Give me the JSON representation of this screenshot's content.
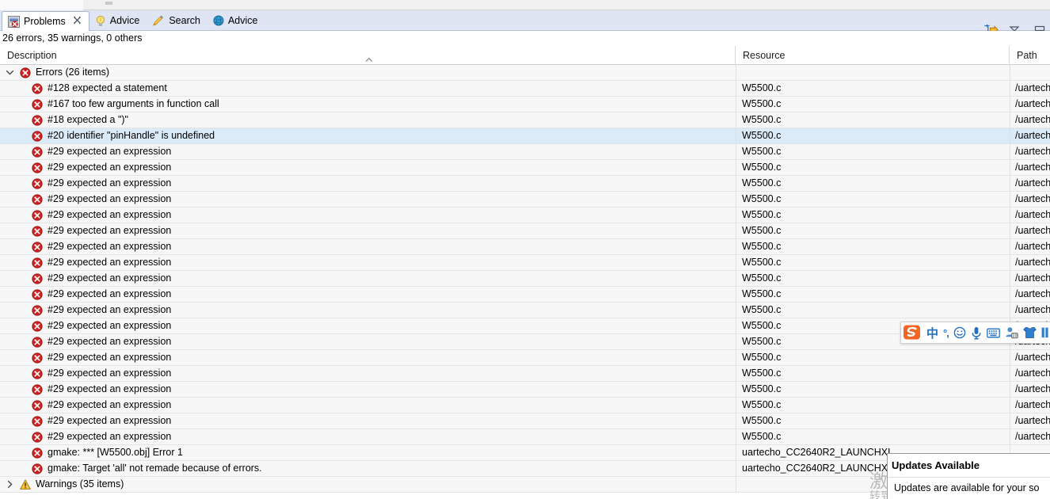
{
  "window": {
    "view_tabs": [
      {
        "label": "Problems",
        "icon": "problems-icon",
        "active": true,
        "closable": true
      },
      {
        "label": "Advice",
        "icon": "bulb-icon",
        "active": false,
        "closable": false
      },
      {
        "label": "Search",
        "icon": "search-icon",
        "active": false,
        "closable": false
      },
      {
        "label": "Advice",
        "icon": "globe-icon",
        "active": false,
        "closable": false
      }
    ],
    "toolbar": [
      {
        "name": "focus-on-active-task-icon",
        "tooltip": "Focus on Active Task"
      },
      {
        "name": "view-menu-icon",
        "tooltip": "View Menu"
      },
      {
        "name": "minimize-icon",
        "tooltip": "Minimize"
      }
    ]
  },
  "summary": "26 errors, 35 warnings, 0 others",
  "table": {
    "columns": [
      {
        "key": "description",
        "label": "Description",
        "sorted": true,
        "sort_direction": "asc"
      },
      {
        "key": "resource",
        "label": "Resource",
        "sorted": false
      },
      {
        "key": "path",
        "label": "Path",
        "sorted": false
      }
    ],
    "rows": [
      {
        "type": "group",
        "expanded": true,
        "severity": "error",
        "description": "Errors (26 items)",
        "resource": "",
        "path": "",
        "selected": false
      },
      {
        "type": "item",
        "severity": "error",
        "description": "#128 expected a statement",
        "resource": "W5500.c",
        "path": "/uartech",
        "selected": false
      },
      {
        "type": "item",
        "severity": "error",
        "description": "#167 too few arguments in function call",
        "resource": "W5500.c",
        "path": "/uartech",
        "selected": false
      },
      {
        "type": "item",
        "severity": "error",
        "description": "#18 expected a \")\"",
        "resource": "W5500.c",
        "path": "/uartech",
        "selected": false
      },
      {
        "type": "item",
        "severity": "error",
        "description": "#20 identifier \"pinHandle\" is undefined",
        "resource": "W5500.c",
        "path": "/uartech",
        "selected": true
      },
      {
        "type": "item",
        "severity": "error",
        "description": "#29 expected an expression",
        "resource": "W5500.c",
        "path": "/uartech",
        "selected": false
      },
      {
        "type": "item",
        "severity": "error",
        "description": "#29 expected an expression",
        "resource": "W5500.c",
        "path": "/uartech",
        "selected": false
      },
      {
        "type": "item",
        "severity": "error",
        "description": "#29 expected an expression",
        "resource": "W5500.c",
        "path": "/uartech",
        "selected": false
      },
      {
        "type": "item",
        "severity": "error",
        "description": "#29 expected an expression",
        "resource": "W5500.c",
        "path": "/uartech",
        "selected": false
      },
      {
        "type": "item",
        "severity": "error",
        "description": "#29 expected an expression",
        "resource": "W5500.c",
        "path": "/uartech",
        "selected": false
      },
      {
        "type": "item",
        "severity": "error",
        "description": "#29 expected an expression",
        "resource": "W5500.c",
        "path": "/uartech",
        "selected": false
      },
      {
        "type": "item",
        "severity": "error",
        "description": "#29 expected an expression",
        "resource": "W5500.c",
        "path": "/uartech",
        "selected": false
      },
      {
        "type": "item",
        "severity": "error",
        "description": "#29 expected an expression",
        "resource": "W5500.c",
        "path": "/uartech",
        "selected": false
      },
      {
        "type": "item",
        "severity": "error",
        "description": "#29 expected an expression",
        "resource": "W5500.c",
        "path": "/uartech",
        "selected": false
      },
      {
        "type": "item",
        "severity": "error",
        "description": "#29 expected an expression",
        "resource": "W5500.c",
        "path": "/uartech",
        "selected": false
      },
      {
        "type": "item",
        "severity": "error",
        "description": "#29 expected an expression",
        "resource": "W5500.c",
        "path": "/uartech",
        "selected": false
      },
      {
        "type": "item",
        "severity": "error",
        "description": "#29 expected an expression",
        "resource": "W5500.c",
        "path": "/uartech",
        "selected": false
      },
      {
        "type": "item",
        "severity": "error",
        "description": "#29 expected an expression",
        "resource": "W5500.c",
        "path": "/uartech",
        "selected": false
      },
      {
        "type": "item",
        "severity": "error",
        "description": "#29 expected an expression",
        "resource": "W5500.c",
        "path": "/uartech",
        "selected": false
      },
      {
        "type": "item",
        "severity": "error",
        "description": "#29 expected an expression",
        "resource": "W5500.c",
        "path": "/uartech",
        "selected": false
      },
      {
        "type": "item",
        "severity": "error",
        "description": "#29 expected an expression",
        "resource": "W5500.c",
        "path": "/uartech",
        "selected": false
      },
      {
        "type": "item",
        "severity": "error",
        "description": "#29 expected an expression",
        "resource": "W5500.c",
        "path": "/uartech",
        "selected": false
      },
      {
        "type": "item",
        "severity": "error",
        "description": "#29 expected an expression",
        "resource": "W5500.c",
        "path": "/uartech",
        "selected": false
      },
      {
        "type": "item",
        "severity": "error",
        "description": "#29 expected an expression",
        "resource": "W5500.c",
        "path": "/uartech",
        "selected": false
      },
      {
        "type": "item",
        "severity": "error",
        "description": "gmake: *** [W5500.obj] Error 1",
        "resource": "uartecho_CC2640R2_LAUNCHXL_",
        "path": "",
        "selected": false
      },
      {
        "type": "item",
        "severity": "error",
        "description": "gmake: Target 'all' not remade because of errors.",
        "resource": "uartecho_CC2640R2_LAUNCHXL_",
        "path": "",
        "selected": false
      },
      {
        "type": "group",
        "expanded": false,
        "severity": "warning",
        "description": "Warnings (35 items)",
        "resource": "",
        "path": "",
        "selected": false
      }
    ]
  },
  "ime_bar": {
    "name": "sogou-input-method-bar",
    "items": [
      {
        "name": "sogou-logo-icon",
        "glyph": "S"
      },
      {
        "name": "chinese-mode-icon",
        "glyph": "中"
      },
      {
        "name": "punctuation-mode-icon",
        "glyph": "°,"
      },
      {
        "name": "emoji-icon",
        "glyph": "☺"
      },
      {
        "name": "voice-input-icon",
        "glyph": "mic"
      },
      {
        "name": "soft-keyboard-icon",
        "glyph": "keyboard"
      },
      {
        "name": "user-account-icon",
        "glyph": "user-card"
      },
      {
        "name": "skin-theme-icon",
        "glyph": "shirt"
      },
      {
        "name": "ime-menu-icon",
        "glyph": "menu"
      }
    ]
  },
  "updates_popup": {
    "title": "Updates Available",
    "body": "Updates are available for your so"
  },
  "watermark": {
    "line1": "激活 Windows",
    "line2": "转到“设置”以激活 Windows。"
  },
  "colors": {
    "tabbar_bg": "#dfe5f2",
    "row_bg": "#f7f7f7",
    "selection_bg": "#dbeaf7",
    "error_red": "#d02020",
    "warning_amber": "#d9a21b",
    "ime_blue": "#1f6fc4"
  }
}
